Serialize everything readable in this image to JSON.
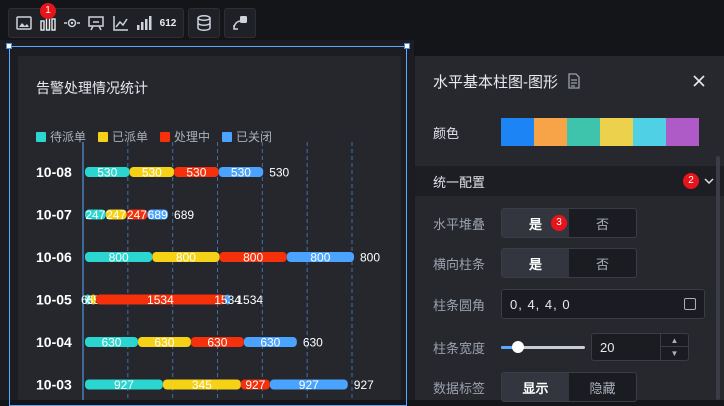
{
  "toolbar": {
    "groups": [
      [
        {
          "icon": "image-icon"
        },
        {
          "icon": "bar-chart-icon",
          "badge": "1",
          "active": true
        },
        {
          "icon": "eye-icon"
        },
        {
          "icon": "chat-chart-icon"
        },
        {
          "icon": "line-axis-icon"
        },
        {
          "icon": "signal-bars-icon"
        },
        {
          "icon": "number-icon",
          "text": "612"
        }
      ],
      [
        {
          "icon": "database-icon"
        }
      ],
      [
        {
          "icon": "interaction-icon"
        }
      ]
    ]
  },
  "card": {
    "title": "告警处理情况统计"
  },
  "chart_data": {
    "type": "bar",
    "orientation": "horizontal",
    "stacked": true,
    "categories": [
      "10-08",
      "10-07",
      "10-06",
      "10-05",
      "10-04",
      "10-03"
    ],
    "series": [
      {
        "name": "待派单",
        "color": "#2bd6d0",
        "values": [
          530,
          247,
          800,
          65,
          630,
          927
        ]
      },
      {
        "name": "已派单",
        "color": "#f5d216",
        "values": [
          530,
          247,
          800,
          65,
          630,
          927
        ]
      },
      {
        "name": "处理中",
        "color": "#f5300b",
        "values": [
          530,
          247,
          800,
          1534,
          630,
          345
        ]
      },
      {
        "name": "已关闭",
        "color": "#4aa3ff",
        "values": [
          530,
          247,
          800,
          65,
          630,
          927
        ]
      }
    ],
    "data_labels": [
      [
        "530",
        "530",
        "530",
        "530"
      ],
      [
        "247",
        "247",
        "247",
        "689"
      ],
      [
        "800",
        "800",
        "800",
        "800"
      ],
      [
        "65",
        "65",
        "1534",
        "1534"
      ],
      [
        "630",
        "630",
        "630",
        "630"
      ],
      [
        "927",
        "345",
        "927",
        "927"
      ]
    ],
    "legend_position": "top-left",
    "grid": true
  },
  "panel": {
    "title": "水平基本柱图-图形",
    "color_label": "颜色",
    "colors": [
      "#1d84f5",
      "#f7a348",
      "#3ec4ad",
      "#ecd24c",
      "#4fd0e4",
      "#ae5bc8"
    ],
    "section_label": "统一配置",
    "section_badge": "2",
    "stack_label": "水平堆叠",
    "stack_yes": "是",
    "stack_no": "否",
    "stack_badge": "3",
    "horizontal_label": "横向柱条",
    "horizontal_yes": "是",
    "horizontal_no": "否",
    "radius_label": "柱条圆角",
    "radius_value": "0, 4, 4, 0",
    "width_label": "柱条宽度",
    "width_value": "20",
    "width_fraction": 0.2,
    "datalabel_label": "数据标签",
    "datalabel_show": "显示",
    "datalabel_hide": "隐藏"
  }
}
